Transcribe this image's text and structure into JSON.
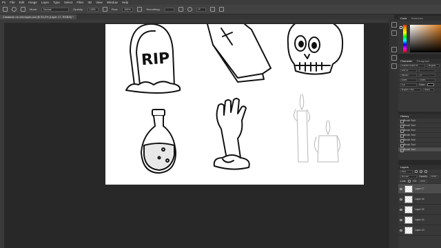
{
  "menu": [
    "Ps",
    "File",
    "Edit",
    "Image",
    "Layer",
    "Type",
    "Select",
    "Filter",
    "3D",
    "View",
    "Window",
    "Help"
  ],
  "options": {
    "mode_label": "Mode:",
    "mode_value": "Normal",
    "opacity_label": "Opacity:",
    "opacity_value": "100%",
    "flow_label": "Flow:",
    "flow_value": "100%",
    "smoothing_label": "Smoothing:",
    "smoothing_value": "",
    "angle_value": "0°"
  },
  "document_tab": "Символы на хэллоуин.psd @ 53,2% (Layer 17, RGB/8) *",
  "canvas": {
    "rip_text": "RIP"
  },
  "color_panel": {
    "tabs": [
      "Color",
      "Swatches"
    ]
  },
  "character_panel": {
    "tabs": [
      "Character",
      "Paragraph"
    ],
    "font_family": "Franklin Gothic D...",
    "font_style": "Regular",
    "size": "5,57 pt",
    "leading": "",
    "kerning": "Metrics",
    "tracking": "0",
    "vscale": "100%",
    "hscale": "100%",
    "baseline": "0 pt",
    "color_label": "Color:",
    "language": "English: USA",
    "aa": "Sharp"
  },
  "history_panel": {
    "title": "History",
    "items": [
      "Brush Tool",
      "Brush Tool",
      "Brush Tool",
      "Brush Tool",
      "Brush Tool",
      "Brush Tool",
      "Brush Tool"
    ]
  },
  "layers_panel": {
    "title": "Layers",
    "filter_kind": "Kind",
    "blend_mode": "Normal",
    "opacity_label": "Opacity:",
    "opacity_value": "100%",
    "lock_label": "Lock:",
    "fill_label": "Fill:",
    "fill_value": "100%",
    "layers": [
      "Layer 17",
      "Layer 16",
      "Layer 15",
      "Layer 14",
      "Layer 13"
    ]
  }
}
